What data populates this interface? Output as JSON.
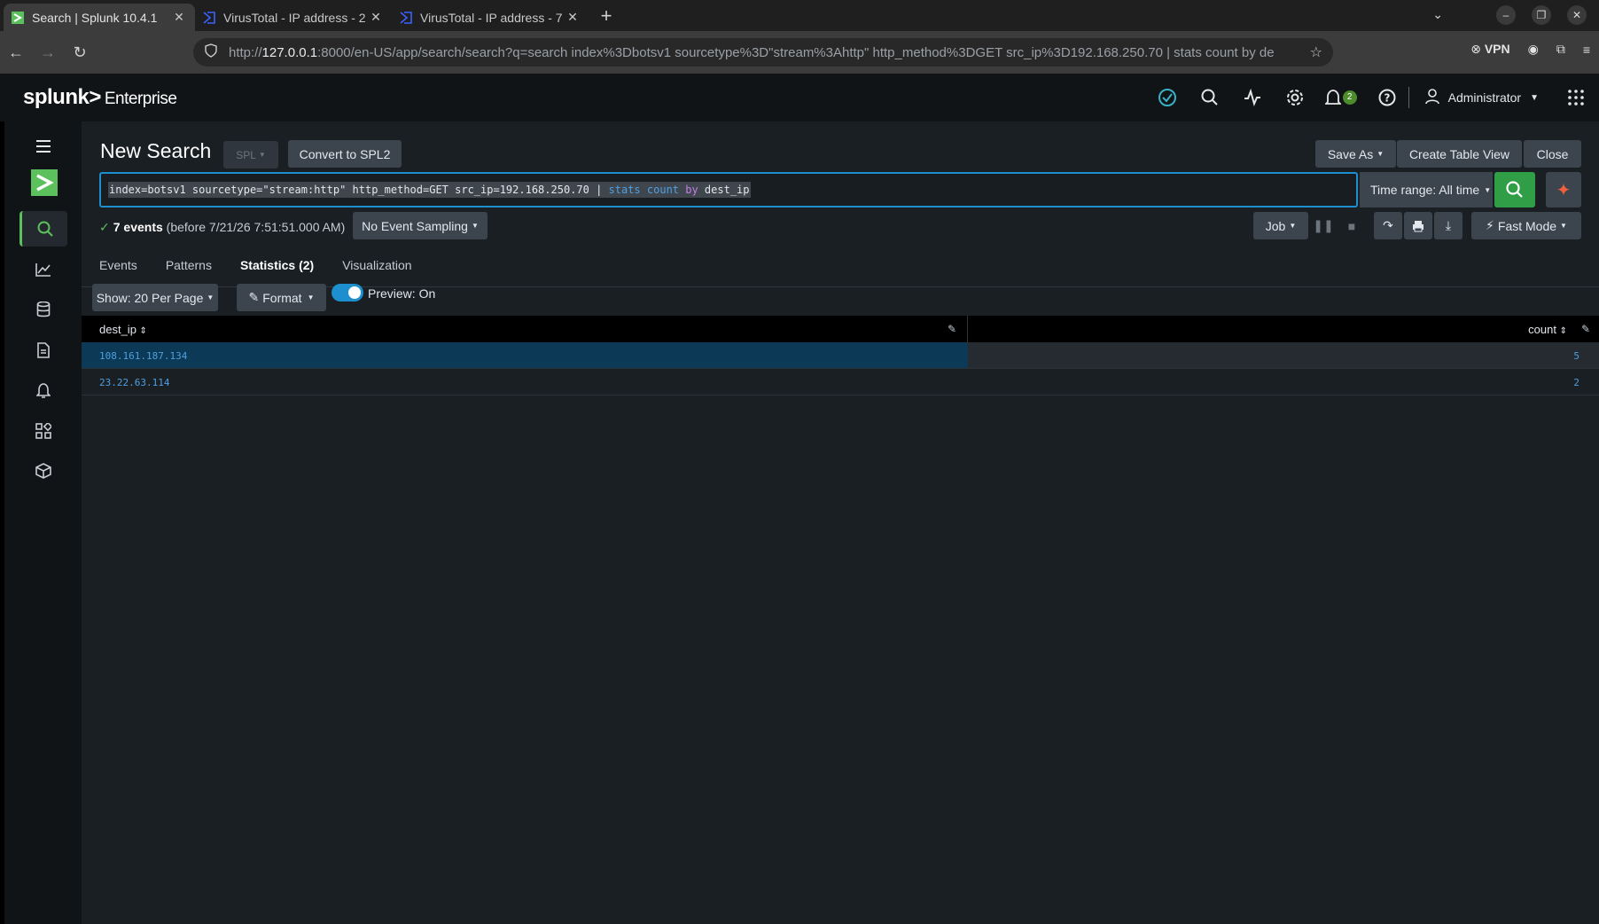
{
  "browser": {
    "tabs": [
      {
        "title": "Search | Splunk 10.4.1",
        "active": true
      },
      {
        "title": "VirusTotal - IP address - 2",
        "active": false
      },
      {
        "title": "VirusTotal - IP address - 7",
        "active": false
      }
    ],
    "url_prefix": "http://",
    "url_host": "127.0.0.1",
    "url_rest": ":8000/en-US/app/search/search?q=search index%3Dbotsv1 sourcetype%3D\"stream%3Ahttp\" http_method%3DGET src_ip%3D192.168.250.70 | stats count by de",
    "vpn_label": "VPN"
  },
  "header": {
    "logo": "splunk>",
    "product": "Enterprise",
    "notifications_count": "2",
    "user": "Administrator"
  },
  "search": {
    "title": "New Search",
    "spl_label": "SPL",
    "convert_label": "Convert to SPL2",
    "save_as_label": "Save As",
    "create_table_label": "Create Table View",
    "close_label": "Close",
    "query_part1": "index=botsv1 sourcetype=\"stream:http\" http_method=GET src_ip=192.168.250.70 | ",
    "query_cmd": "stats",
    "query_space1": " ",
    "query_func": "count",
    "query_space2": " ",
    "query_by": "by",
    "query_field": " dest_ip",
    "time_range": "Time range: All time",
    "events_count": "7 events",
    "events_suffix": "(before 7/21/26 7:51:51.000 AM)",
    "sampling": "No Event Sampling",
    "job_label": "Job",
    "mode_label": "Fast Mode"
  },
  "tabs": [
    {
      "label": "Events"
    },
    {
      "label": "Patterns"
    },
    {
      "label": "Statistics (2)",
      "active": true
    },
    {
      "label": "Visualization"
    }
  ],
  "table_controls": {
    "per_page": "Show: 20 Per Page",
    "format": "Format",
    "preview": "Preview: On"
  },
  "table": {
    "columns": [
      "dest_ip",
      "count"
    ],
    "rows": [
      {
        "dest_ip": "108.161.187.134",
        "count": "5"
      },
      {
        "dest_ip": "23.22.63.114",
        "count": "2"
      }
    ]
  }
}
